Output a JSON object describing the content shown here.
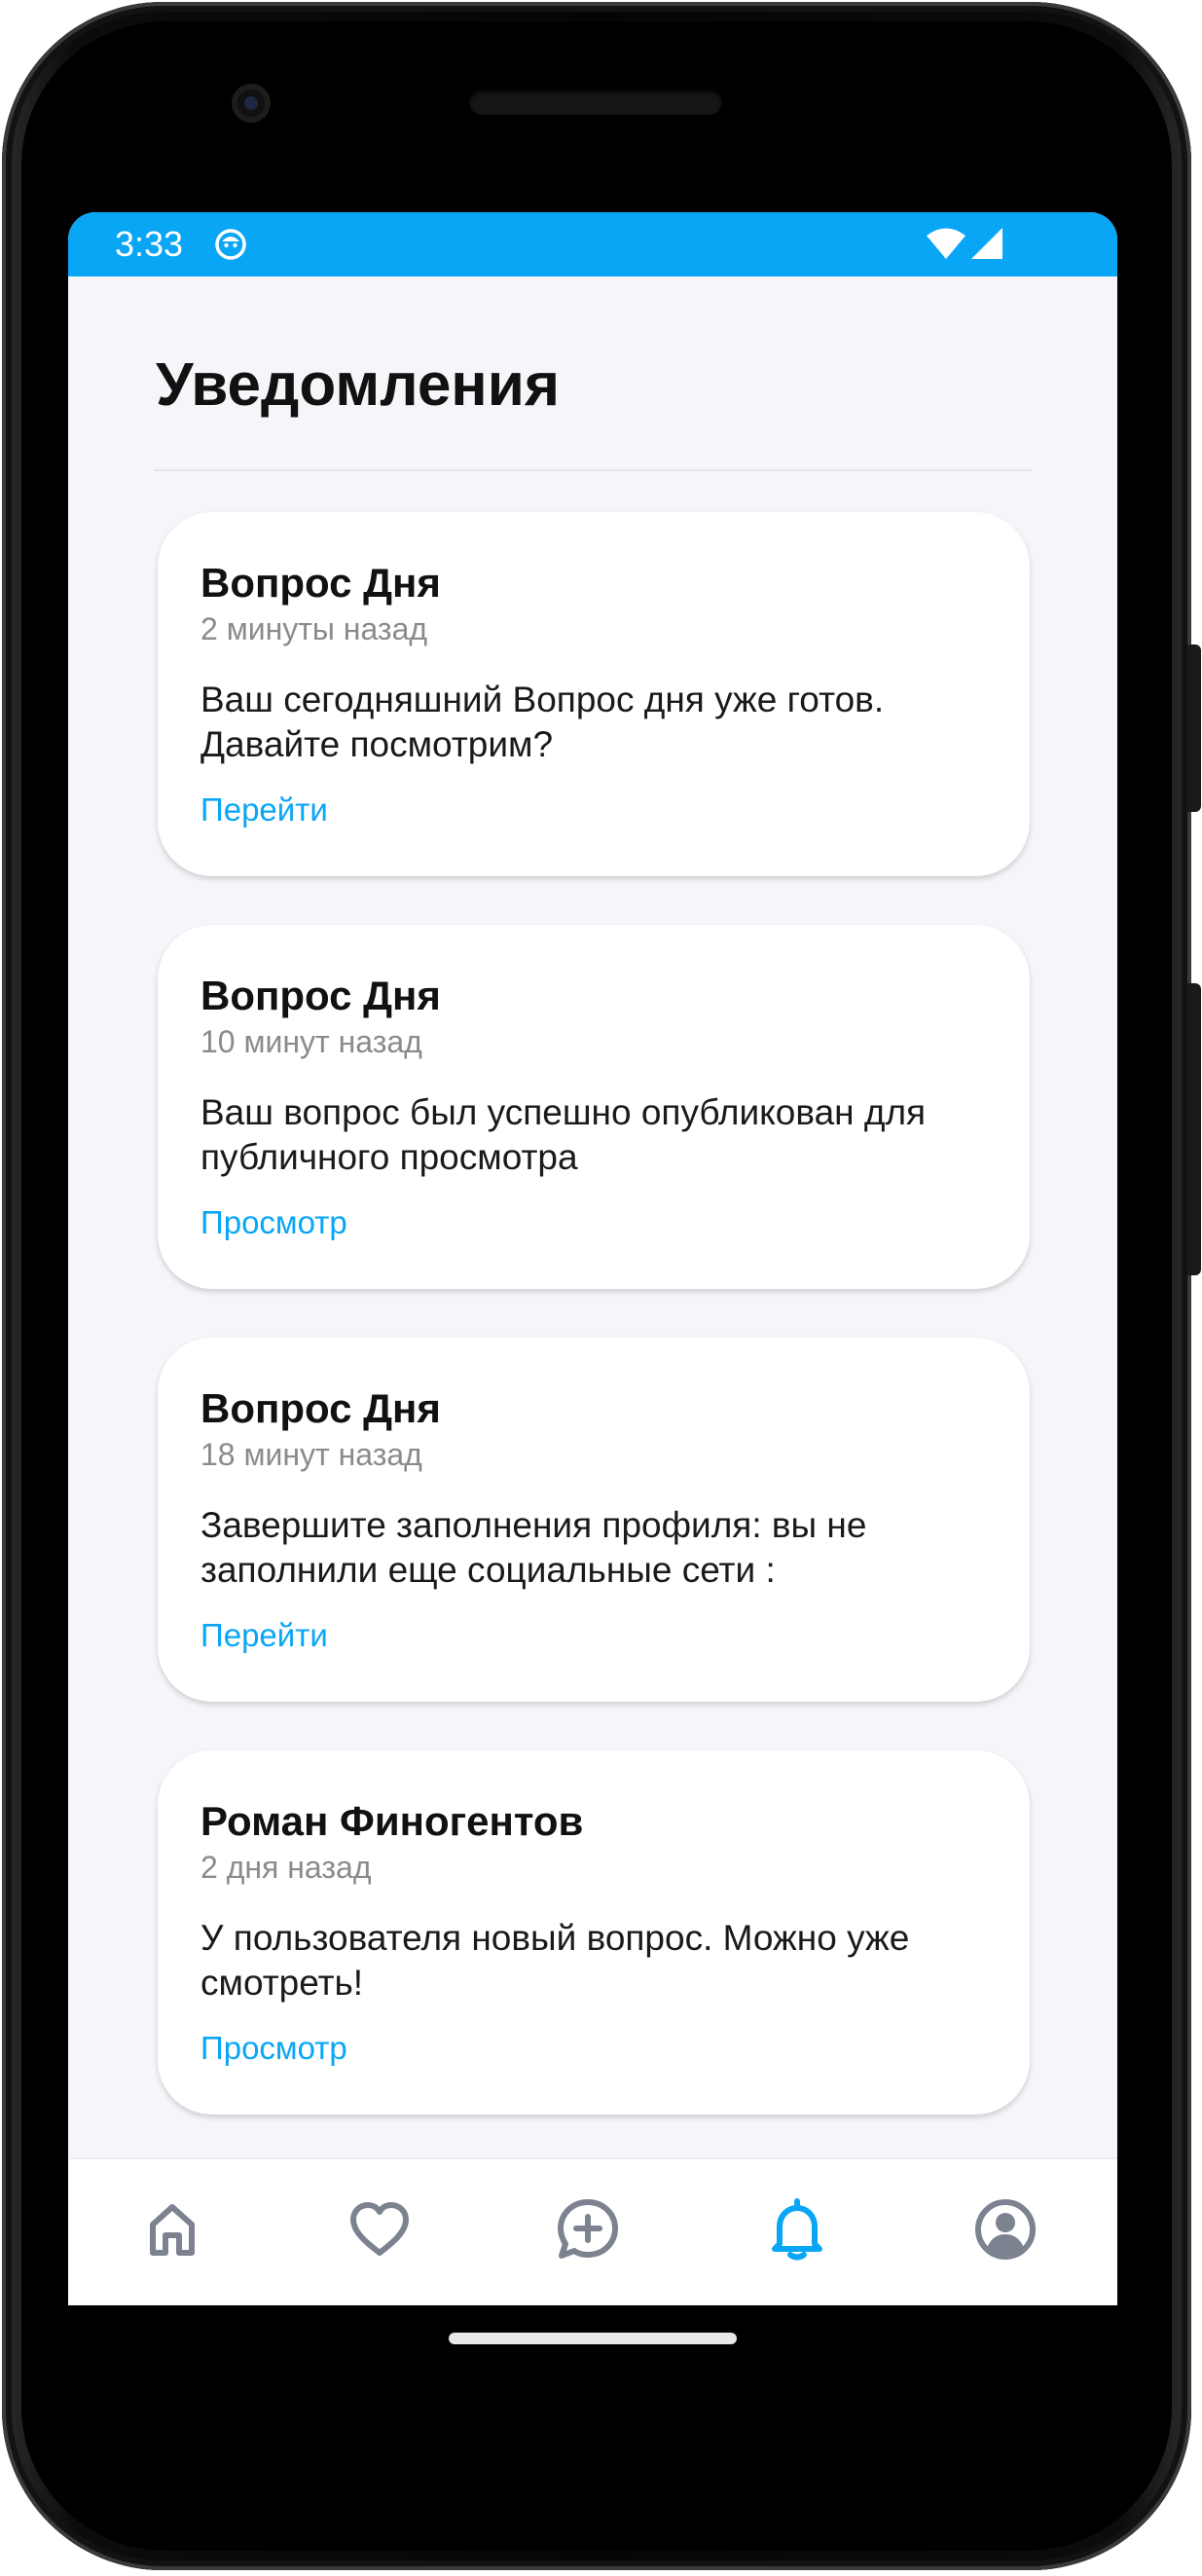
{
  "status_bar": {
    "time": "3:33",
    "app_icon": "face-icon",
    "wifi_icon": "wifi-icon",
    "signal_icon": "signal-icon",
    "color": "#0aa6f6"
  },
  "page": {
    "title": "Уведомления"
  },
  "notifications": [
    {
      "title": "Вопрос Дня",
      "time": "2 минуты назад",
      "body": "Ваш сегодняшний Вопрос дня уже готов. Давайте посмотрим?",
      "action": "Перейти"
    },
    {
      "title": "Вопрос Дня",
      "time": "10 минут назад",
      "body": "Ваш вопрос был успешно опубликован для публичного просмотра",
      "action": "Просмотр"
    },
    {
      "title": "Вопрос Дня",
      "time": "18 минут назад",
      "body": "Завершите заполнения профиля: вы не заполнили еще социальные сети :",
      "action": "Перейти"
    },
    {
      "title": "Роман Финогентов",
      "time": "2 дня назад",
      "body": "У пользователя новый вопрос. Можно уже смотреть!",
      "action": "Просмотр"
    }
  ],
  "bottom_nav": {
    "items": [
      {
        "icon": "home-icon",
        "active": false
      },
      {
        "icon": "heart-icon",
        "active": false
      },
      {
        "icon": "add-chat-icon",
        "active": false
      },
      {
        "icon": "bell-icon",
        "active": true
      },
      {
        "icon": "profile-icon",
        "active": false
      }
    ],
    "active_color": "#0aa6f6",
    "inactive_color": "#7c8290"
  }
}
